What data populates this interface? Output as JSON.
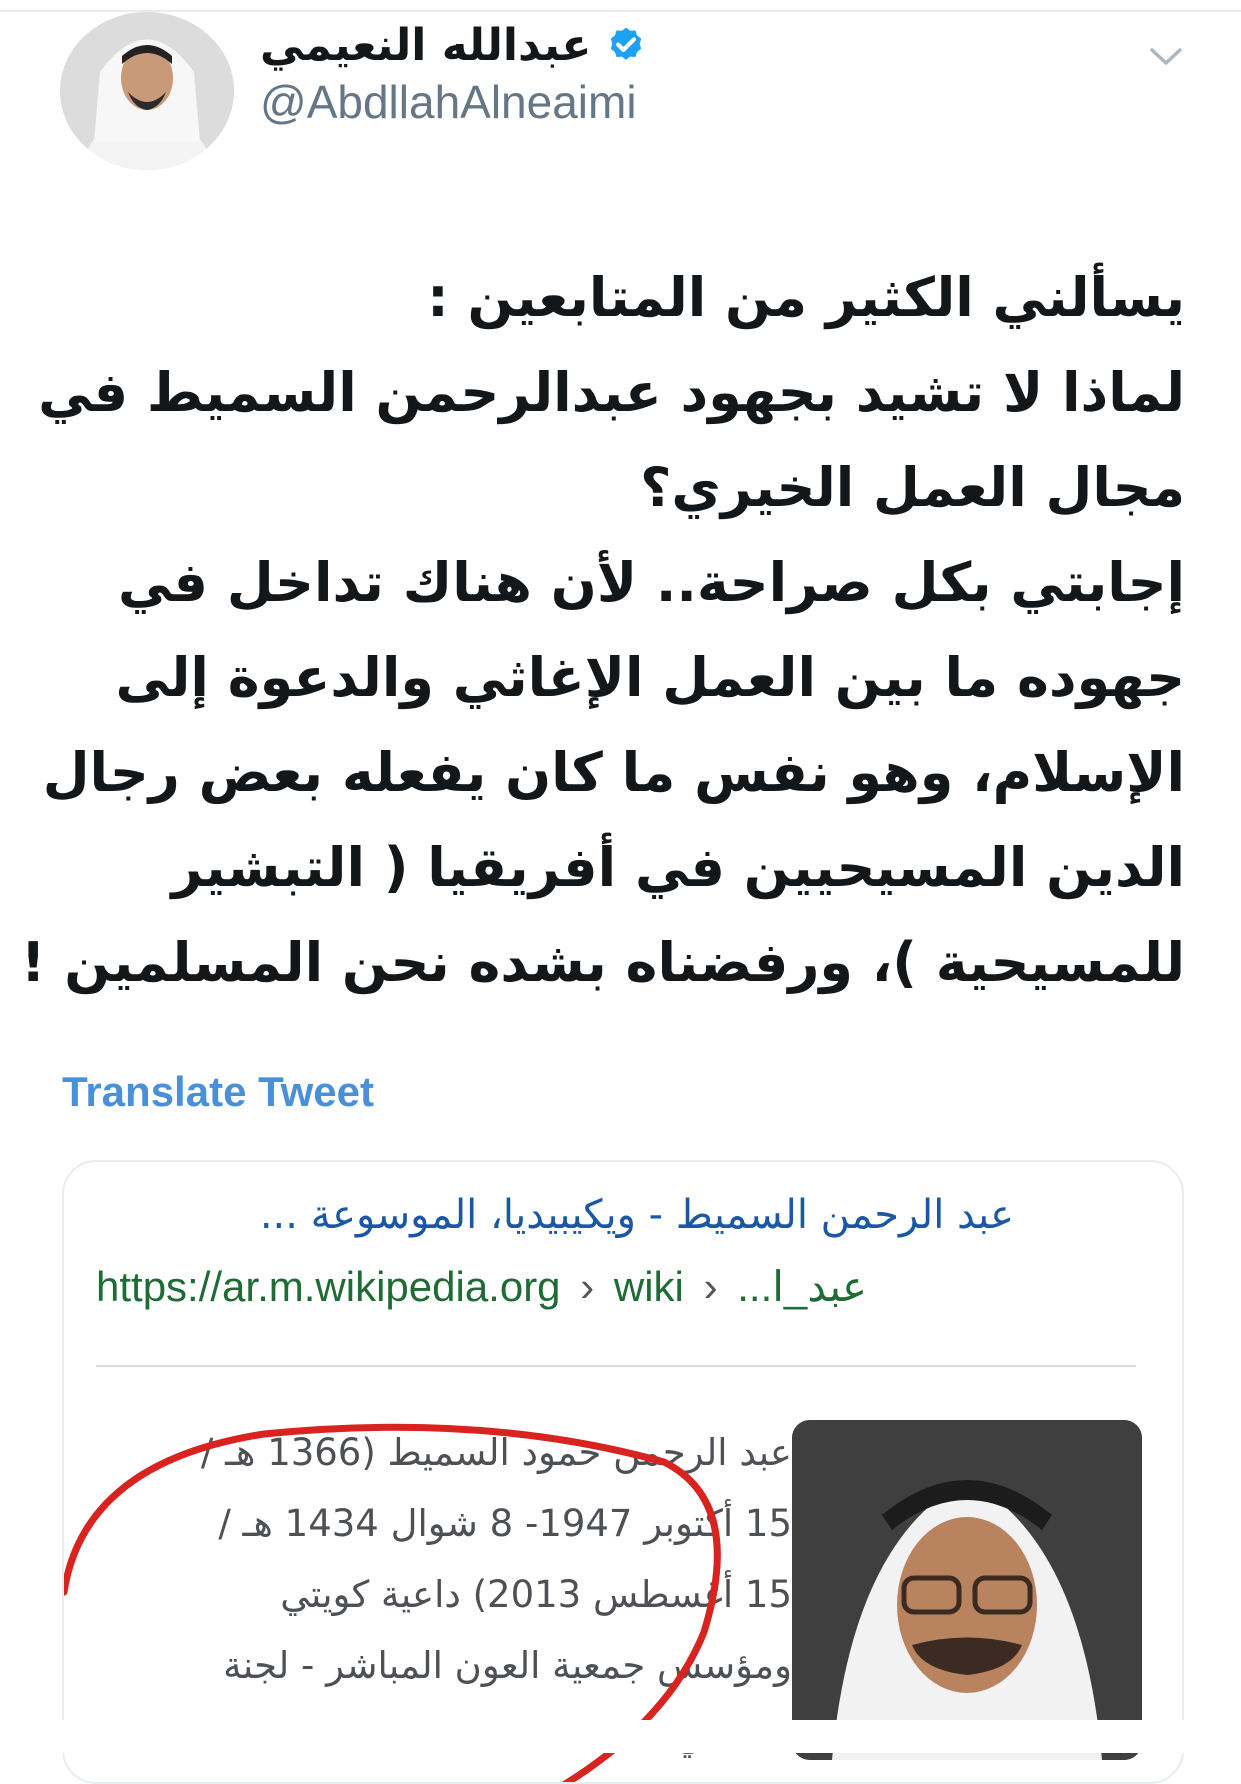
{
  "tweet": {
    "author": {
      "display_name": "عبدالله النعيمي",
      "handle": "@AbdllahAlneaimi",
      "verified": true
    },
    "menu_icon": "chevron-down-icon",
    "body_lines": [
      "يسألني الكثير من المتابعين :",
      "لماذا لا تشيد بجهود عبدالرحمن السميط في",
      "مجال العمل الخيري؟",
      "إجابتي بكل صراحة.. لأن هناك تداخل في",
      "جهوده ما بين العمل الإغاثي والدعوة إلى",
      "الإسلام، وهو نفس ما كان يفعله بعض رجال",
      "الدين المسيحيين في أفريقيا ( التبشير",
      "للمسيحية )، ورفضناه بشده نحن المسلمين !"
    ],
    "translate_label": "Translate Tweet"
  },
  "attached_image": {
    "result_title": "عبد الرحمن السميط - ويكيبيديا، الموسوعة ...",
    "url_domain": "https://ar.m.wikipedia.org",
    "url_separator": "›",
    "url_path_1": "wiki",
    "url_path_2": "...عبد_ا",
    "snippet_lines": [
      "عبد الرحمن حمود السميط (1366 هـ /",
      "15 أكتوبر 1947- 8 شوال 1434 هـ /",
      "15 أغسطس 2013) داعية كويتي",
      "ومؤسس جمعية العون المباشر - لجنة",
      "مسلمي ..."
    ],
    "annotation_color": "#d8231f"
  },
  "colors": {
    "link_blue": "#4a90d9",
    "verified_blue": "#1da1f2",
    "url_green": "#1e6b35",
    "title_blue": "#1a57a4"
  }
}
